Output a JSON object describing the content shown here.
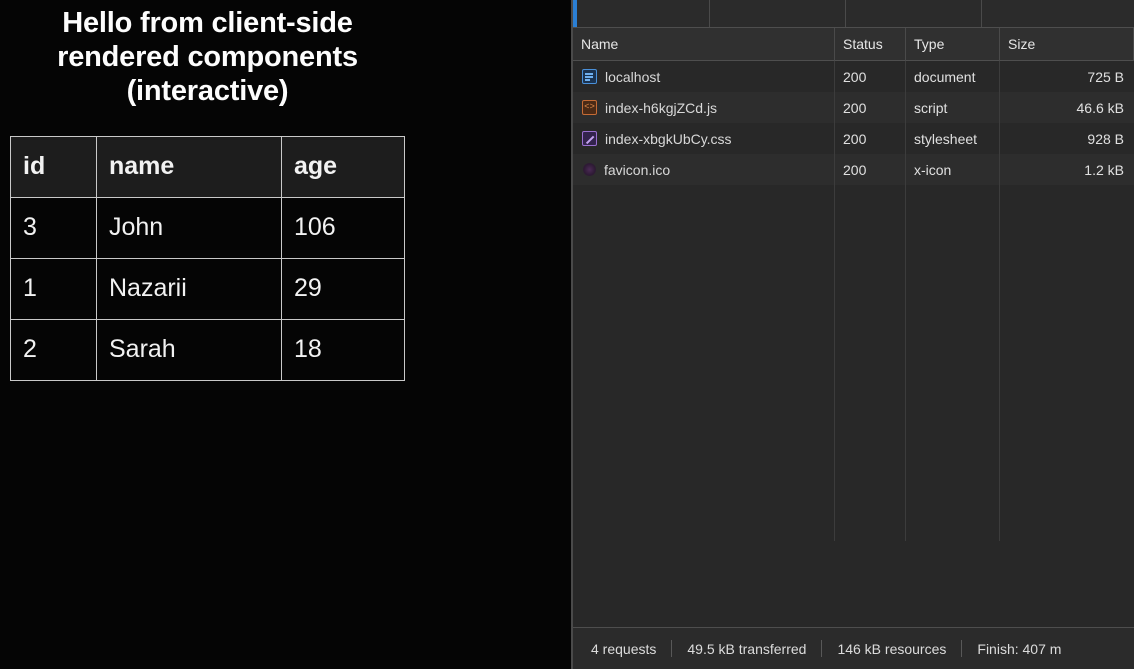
{
  "page": {
    "heading": "Hello from client-side rendered components (interactive)",
    "table": {
      "headers": [
        "id",
        "name",
        "age"
      ],
      "rows": [
        {
          "id": "3",
          "name": "John",
          "age": "106"
        },
        {
          "id": "1",
          "name": "Nazarii",
          "age": "29"
        },
        {
          "id": "2",
          "name": "Sarah",
          "age": "18"
        }
      ]
    }
  },
  "devtools": {
    "panel": "network",
    "accent_color": "#2b7fd4",
    "background_color": "#282828",
    "columns": [
      {
        "key": "name",
        "label": "Name"
      },
      {
        "key": "status",
        "label": "Status"
      },
      {
        "key": "type",
        "label": "Type"
      },
      {
        "key": "size",
        "label": "Size"
      }
    ],
    "requests": [
      {
        "name": "localhost",
        "status": "200",
        "type": "document",
        "size": "725 B",
        "icon": "document-icon",
        "icon_color": "#4a90d9"
      },
      {
        "name": "index-h6kgjZCd.js",
        "status": "200",
        "type": "script",
        "size": "46.6 kB",
        "icon": "script-icon",
        "icon_color": "#c56b35"
      },
      {
        "name": "index-xbgkUbCy.css",
        "status": "200",
        "type": "stylesheet",
        "size": "928 B",
        "icon": "stylesheet-icon",
        "icon_color": "#9a6fd0"
      },
      {
        "name": "favicon.ico",
        "status": "200",
        "type": "x-icon",
        "size": "1.2 kB",
        "icon": "favicon-icon",
        "icon_color": "#4b2b55"
      }
    ],
    "status_bar": {
      "requests": "4 requests",
      "transferred": "49.5 kB transferred",
      "resources": "146 kB resources",
      "finish": "Finish: 407 m"
    }
  }
}
